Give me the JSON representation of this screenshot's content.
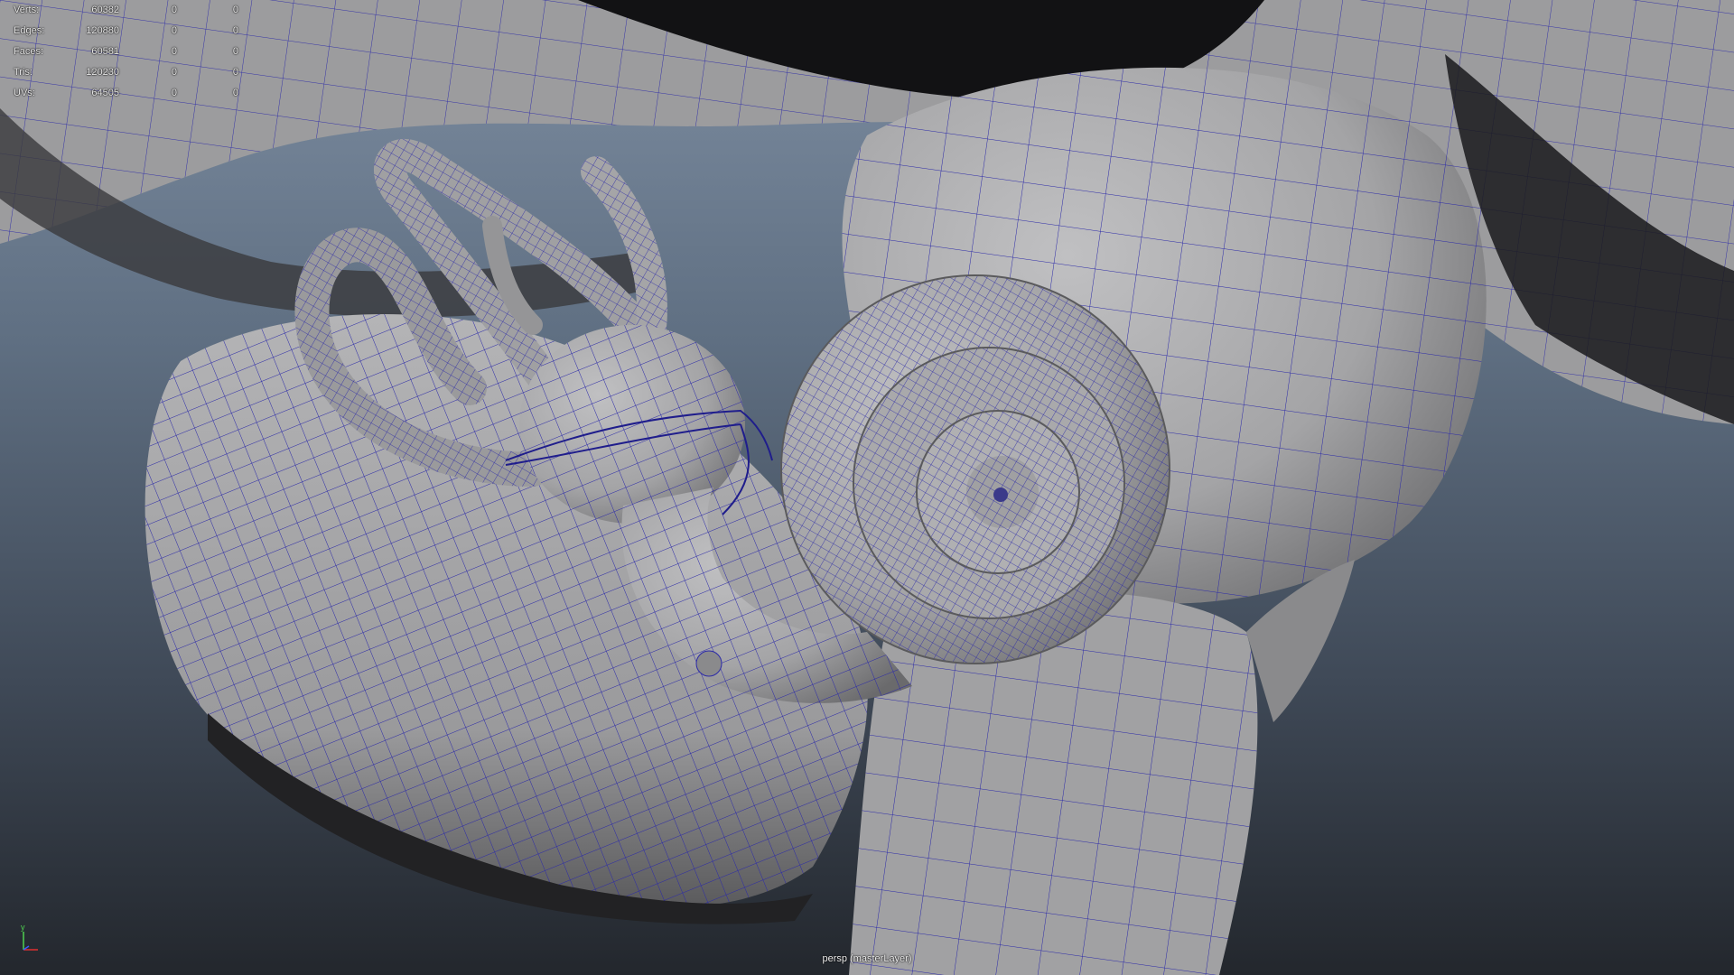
{
  "hud": {
    "rows": [
      {
        "label": "Verts:",
        "v1": "60382",
        "v2": "0",
        "v3": "0"
      },
      {
        "label": "Edges:",
        "v1": "120880",
        "v2": "0",
        "v3": "0"
      },
      {
        "label": "Faces:",
        "v1": "60581",
        "v2": "0",
        "v3": "0"
      },
      {
        "label": "Tris:",
        "v1": "120230",
        "v2": "0",
        "v3": "0"
      },
      {
        "label": "UVs:",
        "v1": "64505",
        "v2": "0",
        "v3": "0"
      }
    ]
  },
  "camera_label": "persp (masterLayer)",
  "axis": {
    "y": "y",
    "x": "x",
    "z": "z"
  },
  "colors": {
    "mesh_fill": "#a3a3a5",
    "mesh_shadow": "#2a2a2c",
    "wire": "#2c2aa8",
    "bg_top": "#7d8da1",
    "bg_bottom": "#23272d"
  },
  "icons": [
    "view-axis-icon"
  ]
}
